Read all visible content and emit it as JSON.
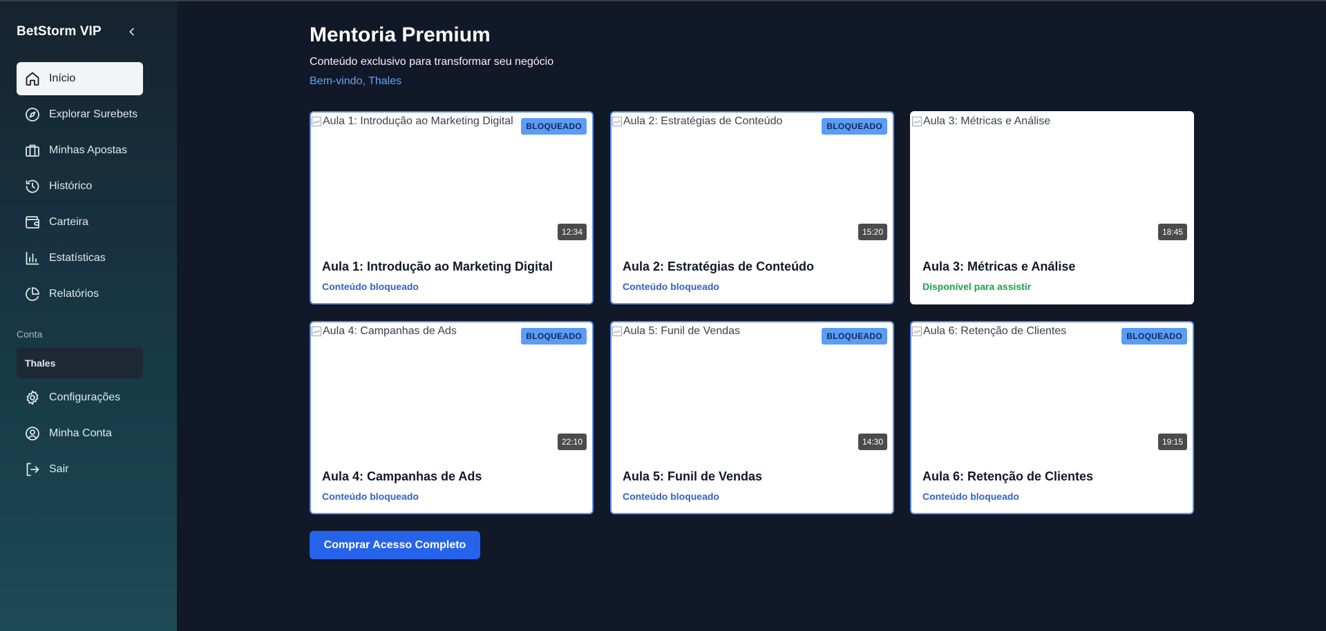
{
  "sidebar": {
    "brand": "BetStorm VIP",
    "items": [
      {
        "label": "Início",
        "icon": "home-icon"
      },
      {
        "label": "Explorar Surebets",
        "icon": "compass-icon"
      },
      {
        "label": "Minhas Apostas",
        "icon": "briefcase-icon"
      },
      {
        "label": "Histórico",
        "icon": "history-icon"
      },
      {
        "label": "Carteira",
        "icon": "wallet-icon"
      },
      {
        "label": "Estatísticas",
        "icon": "bar-chart-icon"
      },
      {
        "label": "Relatórios",
        "icon": "pie-chart-icon"
      }
    ],
    "section_label": "Conta",
    "user": "Thales",
    "account_items": [
      {
        "label": "Configurações",
        "icon": "gear-icon"
      },
      {
        "label": "Minha Conta",
        "icon": "user-circle-icon"
      },
      {
        "label": "Sair",
        "icon": "logout-icon"
      }
    ]
  },
  "main": {
    "title": "Mentoria Premium",
    "subtitle": "Conteúdo exclusivo para transformar seu negócio",
    "welcome": "Bem-vindo, Thales",
    "lessons": [
      {
        "alt": "Aula 1: Introdução ao Marketing Digital",
        "title": "Aula 1: Introdução ao Marketing Digital",
        "badge": "BLOQUEADO",
        "duration": "12:34",
        "status": "Conteúdo bloqueado"
      },
      {
        "alt": "Aula 2: Estratégias de Conteúdo",
        "title": "Aula 2: Estratégias de Conteúdo",
        "badge": "BLOQUEADO",
        "duration": "15:20",
        "status": "Conteúdo bloqueado"
      },
      {
        "alt": "Aula 3: Métricas e Análise",
        "title": "Aula 3: Métricas e Análise",
        "badge": "",
        "duration": "18:45",
        "status": "Disponível para assistir"
      },
      {
        "alt": "Aula 4: Campanhas de Ads",
        "title": "Aula 4: Campanhas de Ads",
        "badge": "BLOQUEADO",
        "duration": "22:10",
        "status": "Conteúdo bloqueado"
      },
      {
        "alt": "Aula 5: Funil de Vendas",
        "title": "Aula 5: Funil de Vendas",
        "badge": "BLOQUEADO",
        "duration": "14:30",
        "status": "Conteúdo bloqueado"
      },
      {
        "alt": "Aula 6: Retenção de Clientes",
        "title": "Aula 6: Retenção de Clientes",
        "badge": "BLOQUEADO",
        "duration": "19:15",
        "status": "Conteúdo bloqueado"
      }
    ],
    "buy_button": "Comprar Acesso Completo"
  },
  "colors": {
    "background": "#111827",
    "accent": "#2563eb",
    "locked_border": "#5b8fe6",
    "available_status": "#16a34a"
  }
}
